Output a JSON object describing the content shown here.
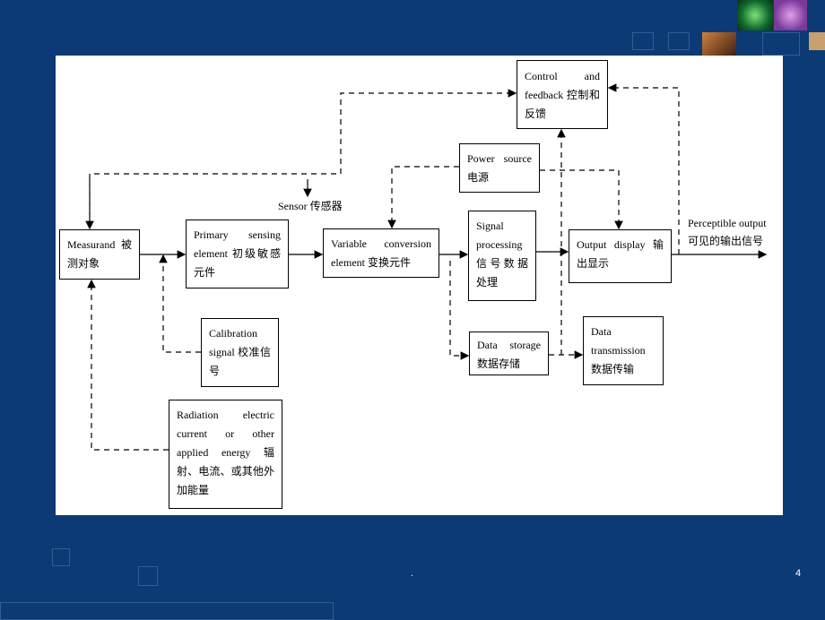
{
  "slide": {
    "page_number": "4",
    "footer_dot": "."
  },
  "colors": {
    "background": "#0c3a74",
    "panel": "#ffffff",
    "line": "#000000"
  },
  "diagram": {
    "measurand": "Measurand 被测对象",
    "primary_sensing": "Primary sensing element 初级敏感元件",
    "variable_conversion": "Variable conversion element 变换元件",
    "signal_processing": "Signal processing 信号数据处理",
    "output_display": "Output display 输出显示",
    "control_feedback": "Control and feedback 控制和反馈",
    "power_source": "Power source 电源",
    "calibration": "Calibration signal 校准信号",
    "radiation": "Radiation electric current or other applied energy 辐射、电流、或其他外加能量",
    "data_storage": "Data storage 数据存储",
    "data_transmission": "Data transmission 数据传输",
    "sensor_label": "Sensor 传感器",
    "output_label_en": "Perceptible output",
    "output_label_cn": "可见的输出信号"
  }
}
